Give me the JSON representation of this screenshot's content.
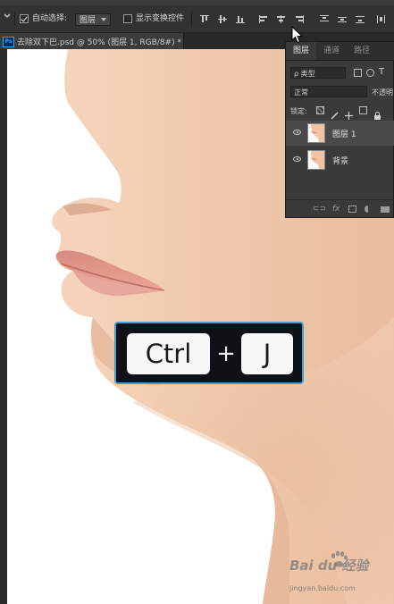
{
  "options_bar": {
    "auto_select_label": "自动选择:",
    "auto_select_value": "图层",
    "show_transform_label": "显示变换控件"
  },
  "document": {
    "tab_title": "去除双下巴.psd @ 50% (图层 1, RGB/8#) *",
    "app_badge": "Ps"
  },
  "layers_panel": {
    "tabs": [
      {
        "label": "图层",
        "active": true
      },
      {
        "label": "通道",
        "active": false
      },
      {
        "label": "路径",
        "active": false
      }
    ],
    "filter_kind": "ρ 类型",
    "blend_mode": "正常",
    "opacity_label": "不透明",
    "lock_label": "锁定:",
    "layers": [
      {
        "name": "图层 1",
        "visible": true,
        "selected": true
      },
      {
        "name": "背景",
        "visible": true,
        "selected": false
      }
    ],
    "footer_fx": "fx"
  },
  "shortcut": {
    "key1": "Ctrl",
    "plus": "+",
    "key2": "J"
  },
  "watermark": {
    "brand": "Bai du 经验",
    "url": "jingyan.baidu.com"
  },
  "colors": {
    "overlay_border": "#3f9fd0",
    "ps_blue": "#31a8ff",
    "skin": "#f2c9ac"
  }
}
